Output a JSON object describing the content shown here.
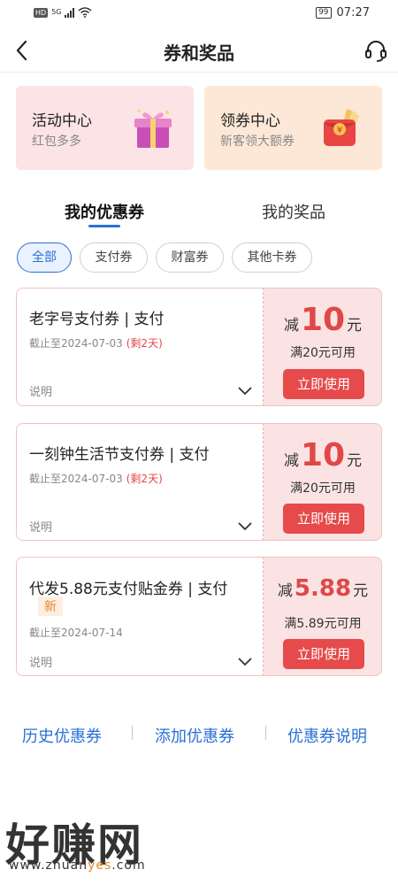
{
  "status_bar": {
    "network": "HD",
    "signal": "5G",
    "battery": "99",
    "time": "07:27"
  },
  "header": {
    "title": "券和奖品",
    "back_icon": "chevron-left-icon",
    "service_icon": "headset-icon"
  },
  "centers": [
    {
      "title": "活动中心",
      "subtitle": "红包多多",
      "icon": "gift-box-icon",
      "bg": "#fbe3e6"
    },
    {
      "title": "领券中心",
      "subtitle": "新客领大额券",
      "icon": "red-envelope-icon",
      "bg": "#fde8d7"
    }
  ],
  "main_tabs": [
    {
      "label": "我的优惠券",
      "active": true
    },
    {
      "label": "我的奖品",
      "active": false
    }
  ],
  "filters": [
    {
      "label": "全部",
      "active": true
    },
    {
      "label": "支付券",
      "active": false
    },
    {
      "label": "财富券",
      "active": false
    },
    {
      "label": "其他卡券",
      "active": false
    }
  ],
  "coupons": [
    {
      "title": "老字号支付券 | 支付",
      "expiry": "截止至2024-07-03",
      "remaining": "(剩2天)",
      "desc": "说明",
      "minus": "减",
      "amount": "10",
      "unit": "元",
      "condition": "满20元可用",
      "button": "立即使用"
    },
    {
      "title": "一刻钟生活节支付券 | 支付",
      "expiry": "截止至2024-07-03",
      "remaining": "(剩2天)",
      "desc": "说明",
      "minus": "减",
      "amount": "10",
      "unit": "元",
      "condition": "满20元可用",
      "button": "立即使用"
    },
    {
      "title": "代发5.88元支付贴金券 | 支付",
      "tag": "新",
      "expiry": "截止至2024-07-14",
      "desc": "说明",
      "minus": "减",
      "amount": "5.88",
      "unit": "元",
      "condition": "满5.89元可用",
      "button": "立即使用"
    }
  ],
  "footer": {
    "history": "历史优惠券",
    "add": "添加优惠券",
    "help": "优惠券说明"
  },
  "watermark": {
    "brand": "好赚网",
    "url_prefix": "www.zhuan",
    "url_highlight": "yes",
    "url_suffix": ".com"
  },
  "colors": {
    "accent": "#2a6fd6",
    "coupon_red": "#e04848",
    "use_button": "#e64a4a"
  }
}
